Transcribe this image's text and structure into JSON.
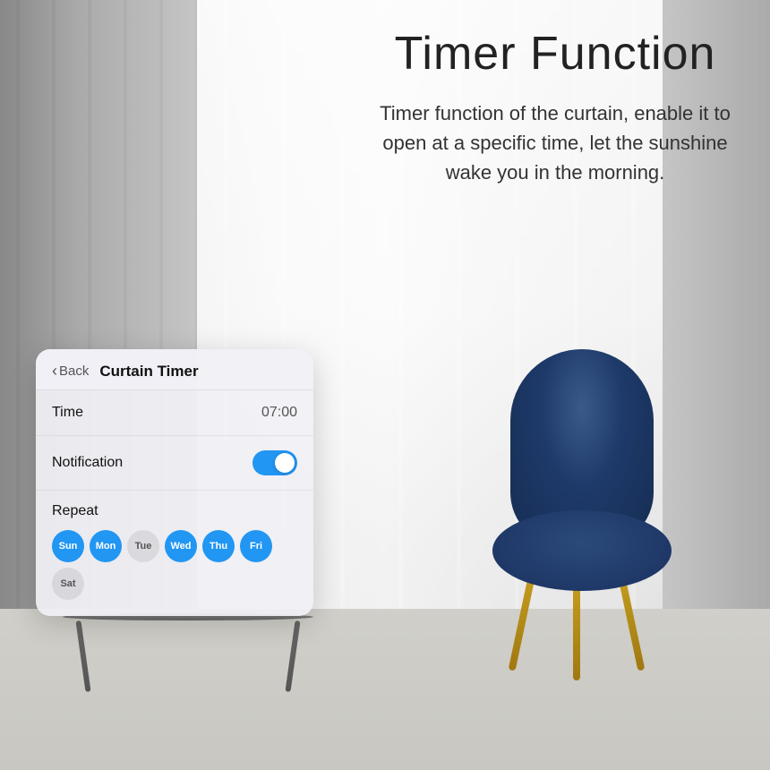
{
  "background": {
    "description": "Room with curtains and chair"
  },
  "header": {
    "title": "Timer Function",
    "description": "Timer function of the curtain, enable it to open at a specific time, let the sunshine wake you in the morning."
  },
  "card": {
    "back_label": "Back",
    "title": "Curtain Timer",
    "time_label": "Time",
    "time_value": "07:00",
    "notification_label": "Notification",
    "notification_enabled": true,
    "repeat_label": "Repeat",
    "days": [
      {
        "id": "sun",
        "label": "Sun",
        "active": true
      },
      {
        "id": "mon",
        "label": "Mon",
        "active": true
      },
      {
        "id": "tue",
        "label": "Tue",
        "active": false
      },
      {
        "id": "wed",
        "label": "Wed",
        "active": true
      },
      {
        "id": "thu",
        "label": "Thu",
        "active": true
      },
      {
        "id": "fri",
        "label": "Fri",
        "active": true
      },
      {
        "id": "sat",
        "label": "Sat",
        "active": false
      }
    ]
  },
  "colors": {
    "accent": "#2196F3",
    "active_day_bg": "#2196F3",
    "active_day_text": "#ffffff",
    "inactive_day_bg": "rgba(0,0,0,0.08)",
    "inactive_day_text": "#555555"
  }
}
